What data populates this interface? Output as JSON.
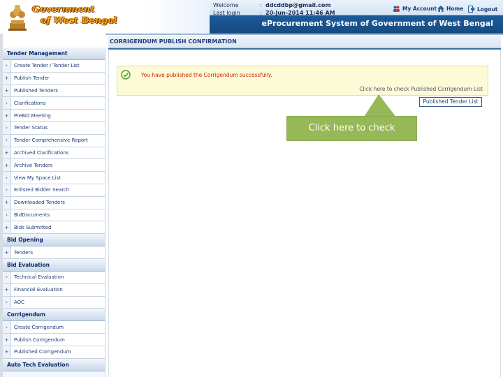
{
  "header": {
    "logo_line1": "Government",
    "logo_line2": "of West Bengal",
    "welcome_label": "Welcome",
    "welcome_value": "ddcddbp@gmail.com",
    "last_login_label": "Last login",
    "last_login_value": "20-Jun-2014 11:46 AM",
    "my_account": "My Account",
    "home": "Home",
    "logout": "Logout",
    "portal_title": "eProcurement System of Government of West Bengal"
  },
  "sidebar": {
    "sections": [
      {
        "title": "Tender Management",
        "items": [
          {
            "label": "Create Tender / Tender List",
            "bullet": "›"
          },
          {
            "label": "Publish Tender",
            "bullet": "+"
          },
          {
            "label": "Published Tenders",
            "bullet": "+"
          },
          {
            "label": "Clarifications",
            "bullet": "›"
          },
          {
            "label": "PreBid Meeting",
            "bullet": "+"
          },
          {
            "label": "Tender Status",
            "bullet": "›"
          },
          {
            "label": "Tender Comprehensive Report",
            "bullet": "›"
          },
          {
            "label": "Archived Clarifications",
            "bullet": "+"
          },
          {
            "label": "Archive Tenders",
            "bullet": "+"
          },
          {
            "label": "View My Space List",
            "bullet": "›"
          },
          {
            "label": "Enlisted Bidder Search",
            "bullet": "›"
          },
          {
            "label": "Downloaded Tenders",
            "bullet": "+"
          },
          {
            "label": "BidDocuments",
            "bullet": "›"
          },
          {
            "label": "Bids Submitted",
            "bullet": "+"
          }
        ]
      },
      {
        "title": "Bid Opening",
        "items": [
          {
            "label": "Tenders",
            "bullet": "+"
          }
        ]
      },
      {
        "title": "Bid Evaluation",
        "items": [
          {
            "label": "Technical Evaluation",
            "bullet": "›"
          },
          {
            "label": "Financial Evaluation",
            "bullet": "+"
          },
          {
            "label": "AOC",
            "bullet": "›"
          }
        ]
      },
      {
        "title": "Corrigendum",
        "items": [
          {
            "label": "Create Corrigendum",
            "bullet": "›"
          },
          {
            "label": "Publish Corrigendum",
            "bullet": "+"
          },
          {
            "label": "Published Corrigendum",
            "bullet": "+"
          }
        ]
      },
      {
        "title": "Auto Tech Evaluation",
        "items": []
      }
    ]
  },
  "main": {
    "page_title": "CORRIGENDUM PUBLISH CONFIRMATION",
    "success_message": "You have published the Corrigendum successfully.",
    "check_link": "Click here to check Published Corrigendum List",
    "list_button": "Published Tender List",
    "callout": "Click here to check"
  },
  "colors": {
    "header_band": "#1c5b9b",
    "logo_text": "#f4a21b",
    "success_bg": "#fdfbd7",
    "success_text": "#cc2200",
    "callout_bg": "#96b857"
  }
}
